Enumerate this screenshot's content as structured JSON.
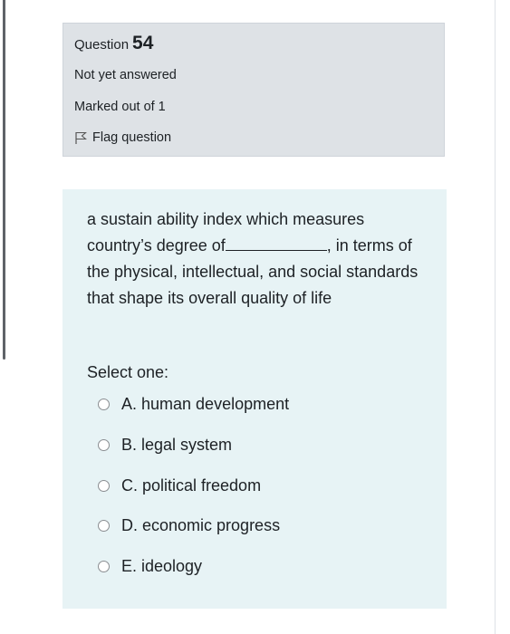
{
  "question": {
    "label": "Question",
    "number": "54",
    "state": "Not yet answered",
    "grade": "Marked out of 1",
    "flag_label": "Flag question"
  },
  "content": {
    "text_before_blank": "a sustain ability index which measures country’s degree of",
    "text_after_blank": ", in terms of the physical, intellectual, and social standards that shape its overall quality of life",
    "prompt": "Select one:",
    "answers": [
      {
        "label": "A. human development"
      },
      {
        "label": "B. legal system"
      },
      {
        "label": "C. political freedom"
      },
      {
        "label": "D. economic progress"
      },
      {
        "label": "E. ideology"
      }
    ]
  }
}
